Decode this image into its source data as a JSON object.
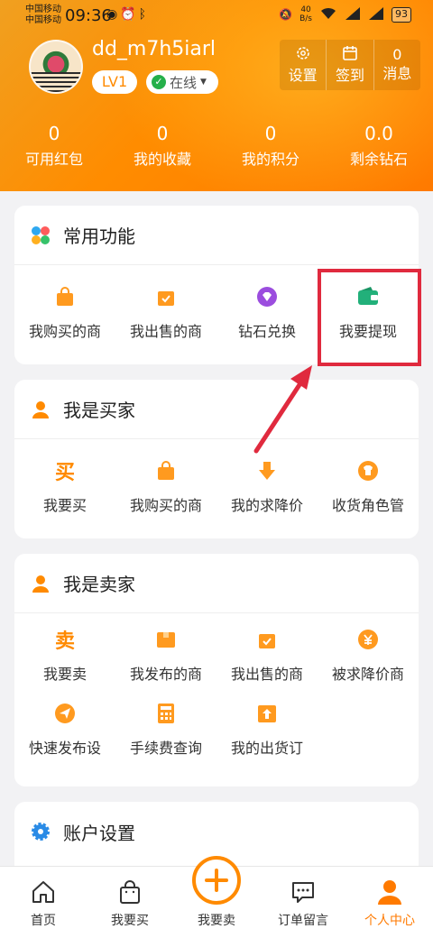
{
  "status_bar": {
    "carrier_1": "中国移动",
    "carrier_2": "中国移动",
    "time": "09:36",
    "net_speed_value": "40",
    "net_speed_unit": "B/s",
    "battery": "93"
  },
  "profile": {
    "username": "dd_m7h5iarl",
    "level": "LV1",
    "status": "在线"
  },
  "quick_actions": [
    {
      "label": "设置",
      "icon": "gear-icon"
    },
    {
      "label": "签到",
      "icon": "calendar-icon"
    },
    {
      "label": "消息",
      "value": "0"
    }
  ],
  "stats": [
    {
      "value": "0",
      "label": "可用红包"
    },
    {
      "value": "0",
      "label": "我的收藏"
    },
    {
      "value": "0",
      "label": "我的积分"
    },
    {
      "value": "0.0",
      "label": "剩余钻石"
    }
  ],
  "sections": {
    "common": {
      "title": "常用功能",
      "items": [
        {
          "label": "我购买的商",
          "icon": "shopping-bag-icon"
        },
        {
          "label": "我出售的商",
          "icon": "sold-bag-icon"
        },
        {
          "label": "钻石兑换",
          "icon": "diamond-icon"
        },
        {
          "label": "我要提现",
          "icon": "wallet-icon"
        }
      ]
    },
    "buyer": {
      "title": "我是买家",
      "items": [
        {
          "label": "我要买",
          "glyph": "买"
        },
        {
          "label": "我购买的商",
          "icon": "shopping-bag-icon"
        },
        {
          "label": "我的求降价",
          "icon": "price-down-icon"
        },
        {
          "label": "收货角色管",
          "icon": "shirt-icon"
        }
      ]
    },
    "seller": {
      "title": "我是卖家",
      "items": [
        {
          "label": "我要卖",
          "glyph": "卖"
        },
        {
          "label": "我发布的商",
          "icon": "box-icon"
        },
        {
          "label": "我出售的商",
          "icon": "sold-bag-icon"
        },
        {
          "label": "被求降价商",
          "icon": "yuan-down-icon"
        },
        {
          "label": "快速发布设",
          "icon": "send-icon"
        },
        {
          "label": "手续费查询",
          "icon": "calculator-icon"
        },
        {
          "label": "我的出货订",
          "icon": "upload-box-icon"
        }
      ]
    },
    "account": {
      "title": "账户设置"
    }
  },
  "bottom_nav": [
    {
      "label": "首页",
      "icon": "home-icon"
    },
    {
      "label": "我要买",
      "icon": "shopping-bag-icon"
    },
    {
      "label": "我要卖",
      "icon": "plus-circle-icon"
    },
    {
      "label": "订单留言",
      "icon": "chat-icon"
    },
    {
      "label": "个人中心",
      "icon": "person-icon",
      "active": true
    }
  ],
  "colors": {
    "accent": "#ff8a00",
    "highlight_box": "#e02a3e",
    "online_green": "#25b04a"
  }
}
